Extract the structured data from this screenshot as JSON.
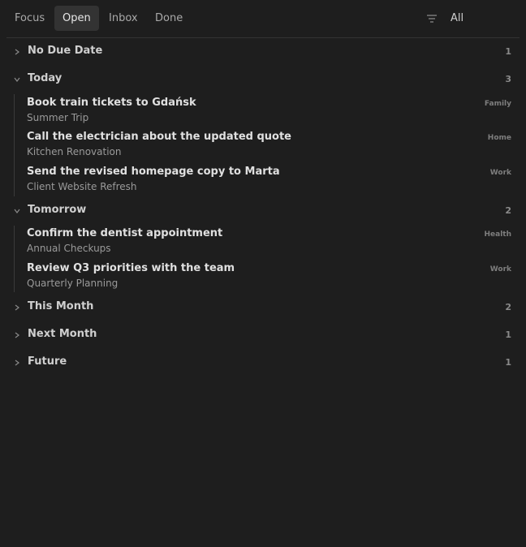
{
  "tabs": [
    {
      "label": "Focus"
    },
    {
      "label": "Open"
    },
    {
      "label": "Inbox"
    },
    {
      "label": "Done"
    }
  ],
  "active_tab": "Open",
  "filter": {
    "label": "All",
    "icon": "filter-icon"
  },
  "groups": [
    {
      "title": "No Due Date",
      "count": "1",
      "expanded": false,
      "tasks": []
    },
    {
      "title": "Today",
      "count": "3",
      "expanded": true,
      "tasks": [
        {
          "title": "Book train tickets to Gdańsk",
          "project": "Summer Trip",
          "tag": "Family"
        },
        {
          "title": "Call the electrician about the updated quote",
          "project": "Kitchen Renovation",
          "tag": "Home"
        },
        {
          "title": "Send the revised homepage copy to Marta",
          "project": "Client Website Refresh",
          "tag": "Work"
        }
      ]
    },
    {
      "title": "Tomorrow",
      "count": "2",
      "expanded": true,
      "tasks": [
        {
          "title": "Confirm the dentist appointment",
          "project": "Annual Checkups",
          "tag": "Health"
        },
        {
          "title": "Review Q3 priorities with the team",
          "project": "Quarterly Planning",
          "tag": "Work"
        }
      ]
    },
    {
      "title": "This Month",
      "count": "2",
      "expanded": false,
      "tasks": []
    },
    {
      "title": "Next Month",
      "count": "1",
      "expanded": false,
      "tasks": []
    },
    {
      "title": "Future",
      "count": "1",
      "expanded": false,
      "tasks": []
    }
  ],
  "colors": {
    "background": "#1e1e1e",
    "active_tab": "#333333",
    "text": "#e0e0e0",
    "muted": "#9a9a9a"
  }
}
